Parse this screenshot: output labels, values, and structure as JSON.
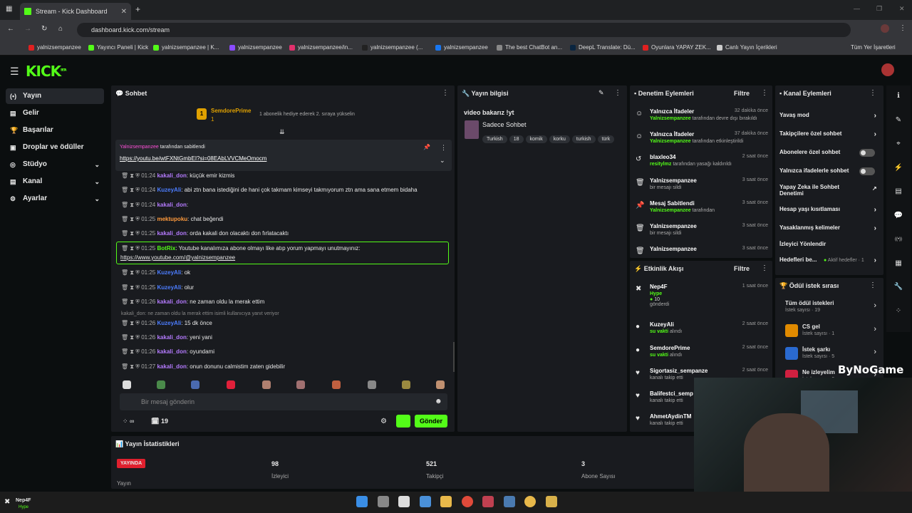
{
  "browser": {
    "tab_title": "Stream - Kick Dashboard",
    "url": "dashboard.kick.com/stream",
    "bookmarks": [
      "yalnizsempanzee",
      "Yayıncı Paneli | Kick",
      "yalnizsempanzee | K...",
      "yalnizsempanzee",
      "yalnizsempanzee/in...",
      "yalnizsempanzee (...",
      "yalnizsempanzee",
      "The best ChatBot an...",
      "DeepL Translate: Dü...",
      "Oyunlara YAPAY ZEK...",
      "Canlı Yayın İçerikleri"
    ],
    "all_bookmarks": "Tüm Yer İşaretleri"
  },
  "brand": {
    "logo": "KICK",
    "logo_sup": "BETA",
    "accent": "#53fc18"
  },
  "sidebar": {
    "items": [
      "Yayın",
      "Gelir",
      "Başarılar",
      "Droplar ve ödüller",
      "Stüdyo",
      "Kanal",
      "Ayarlar"
    ]
  },
  "chat": {
    "title": "Sohbet",
    "top_user": "SemdorePrime",
    "top_rank": "1",
    "top_count": "1",
    "sub_msg": "1 abonelik hediye ederek 2. sıraya yükselin",
    "pinned_by": "Yalnizsempanzee",
    "pinned_suffix": "tarafından sabitlendi",
    "pinned_link": "https://youtu.be/wtFXNtGmbEI?si=08EAbLVVCMeOmocm",
    "messages": [
      {
        "time": "01:24",
        "user": "kakali_don",
        "text": "küçük emir kizmis",
        "color": "#b57bff"
      },
      {
        "time": "01:24",
        "user": "KuzeyAli",
        "text": "abi ztn bana istediğini de hani çok takmam kimseyi takmıyorum ztn ama sana etmem bidaha",
        "color": "#4c7dff"
      },
      {
        "time": "01:24",
        "user": "kakali_don",
        "text": "",
        "color": "#b57bff"
      },
      {
        "time": "01:25",
        "user": "mektupoku",
        "text": "chat beğendi",
        "color": "#ff9a3c"
      },
      {
        "time": "01:25",
        "user": "kakali_don",
        "text": "orda kakali don olacaktı don fırlatacaktı",
        "color": "#b57bff"
      },
      {
        "time": "01:25",
        "user": "BotRix",
        "text": "Youtube kanalımıza abone olmayı like atıp yorum yapmayı unutmayınız:",
        "color": "#53fc18",
        "link": "https://www.youtube.com/@yalnizsempanzee"
      },
      {
        "time": "01:25",
        "user": "KuzeyAli",
        "text": "ok",
        "color": "#4c7dff"
      },
      {
        "time": "01:25",
        "user": "KuzeyAli",
        "text": "olur",
        "color": "#4c7dff"
      },
      {
        "time": "01:26",
        "user": "kakali_don",
        "text": "ne zaman oldu la merak ettim",
        "color": "#b57bff"
      },
      {
        "time": "01:26",
        "user": "KuzeyAli",
        "text": "15 dk önce",
        "color": "#4c7dff",
        "reply": "kakali_don: ne zaman oldu la merak ettim isimli kullanıcıya yanıt veriyor"
      },
      {
        "time": "01:26",
        "user": "kakali_don",
        "text": "yeni yani",
        "color": "#b57bff"
      },
      {
        "time": "01:26",
        "user": "kakali_don",
        "text": "oyundami",
        "color": "#b57bff"
      },
      {
        "time": "01:27",
        "user": "kakali_don",
        "text": "onun donunu calmistim zaten gidebilir",
        "color": "#b57bff"
      }
    ],
    "input_placeholder": "Bir mesaj gönderin",
    "infinity": "∞",
    "count": "19",
    "send": "Gönder"
  },
  "stream_info": {
    "title": "Yayın bilgisi",
    "stream_title": "video bakarız !yt",
    "chat_mode": "Sadece Sohbet",
    "tags": [
      "Turkish",
      "18",
      "komik",
      "korku",
      "turkish",
      "türk"
    ]
  },
  "moderation": {
    "title": "Denetim Eylemleri",
    "filter": "Filtre",
    "items": [
      {
        "t": "Yalnızca İfadeler",
        "s": "Yalnizsempanzee",
        "rest": "tarafından devre dışı bırakıldı",
        "d": "32 dakika önce",
        "icon": "☺"
      },
      {
        "t": "Yalnızca İfadeler",
        "s": "Yalnizsempanzee",
        "rest": "tarafından etkinleştirildi",
        "d": "37 dakika önce",
        "icon": "☺"
      },
      {
        "t": "blaxleo34",
        "s": "resitylmz",
        "rest": "tarafından yasağı kaldırıldı",
        "d": "2 saat önce",
        "icon": "↺"
      },
      {
        "t": "Yalnizsempanzee",
        "s": "",
        "rest": "bir mesajı sildi",
        "d": "3 saat önce",
        "icon": "🗑"
      },
      {
        "t": "Mesaj Sabitlendi",
        "s": "Yalnizsempanzee",
        "rest": "tarafından",
        "d": "3 saat önce",
        "icon": "📌"
      },
      {
        "t": "Yalnizsempanzee",
        "s": "",
        "rest": "bir mesajı sildi",
        "d": "3 saat önce",
        "icon": "🗑"
      },
      {
        "t": "Yalnizsempanzee",
        "s": "",
        "rest": "",
        "d": "3 saat önce",
        "icon": "🗑"
      }
    ]
  },
  "activity": {
    "title": "Etkinlik Akışı",
    "filter": "Filtre",
    "items": [
      {
        "t": "Nep4F",
        "s": "Hype",
        "rest": "",
        "extra": "10",
        "extra2": "gönderdi",
        "d": "1 saat önce",
        "icon": "✖"
      },
      {
        "t": "KuzeyAli",
        "s": "su vakti",
        "rest": "alındı",
        "d": "2 saat önce",
        "icon": "●"
      },
      {
        "t": "SemdorePrime",
        "s": "su vakti",
        "rest": "alındı",
        "d": "2 saat önce",
        "icon": "●"
      },
      {
        "t": "Sigortasiz_sempanze",
        "s": "",
        "rest": "kanalı takip etti",
        "d": "2 saat önce",
        "icon": "♥"
      },
      {
        "t": "Balifestci_semp",
        "s": "",
        "rest": "kanalı takip etti",
        "d": "",
        "icon": "♥"
      },
      {
        "t": "AhmetAydinTM",
        "s": "",
        "rest": "kanalı takip etti",
        "d": "",
        "icon": "♥"
      }
    ]
  },
  "channel_actions": {
    "title": "Kanal Eylemleri",
    "items": [
      "Yavaş mod",
      "Takipçilere özel sohbet",
      "Abonelere özel sohbet",
      "Yalnızca ifadelerle sohbet",
      "Yapay Zeka ile Sohbet Denetimi",
      "Hesap yaşı kısıtlaması",
      "Yasaklanmış kelimeler",
      "İzleyici Yönlendir",
      "Hedefleri be..."
    ],
    "active_goals": "Aktif hedefler · 1"
  },
  "rewards": {
    "title": "Ödül istek sırası",
    "items": [
      {
        "t": "Tüm ödül istekleri",
        "s": "İstek sayısı · 19"
      },
      {
        "t": "CS gel",
        "s": "İstek sayısı · 1"
      },
      {
        "t": "İstek şarkı",
        "s": "İstek sayısı · 5"
      },
      {
        "t": "Ne izleyelim",
        "s": "İstek sayısı · 0"
      }
    ]
  },
  "stats": {
    "title": "Yayın İstatistikleri",
    "live": "YAYINDA",
    "live_lbl": "Yayın",
    "viewers": "98",
    "viewers_lbl": "İzleyici",
    "followers": "521",
    "followers_lbl": "Takipçi",
    "subs": "3",
    "subs_lbl": "Abone Sayısı"
  },
  "watermark": "ByNoGame",
  "notification": {
    "user": "Nep4F",
    "sub": "Hype"
  }
}
